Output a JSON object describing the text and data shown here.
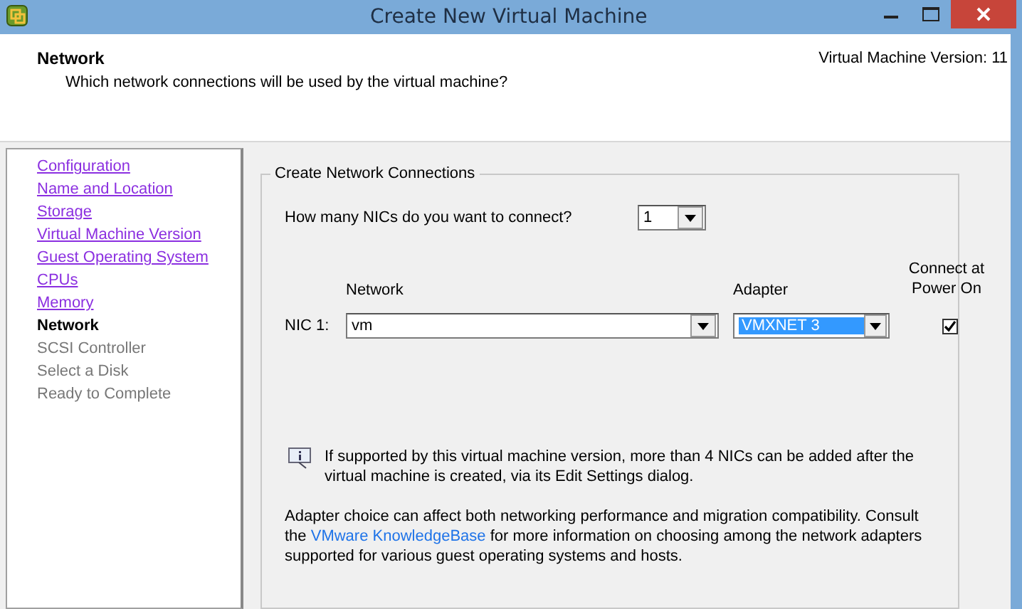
{
  "window": {
    "title": "Create New Virtual Machine"
  },
  "header": {
    "title": "Network",
    "subtitle": "Which network connections will be used by the virtual machine?",
    "version": "Virtual Machine Version: 11"
  },
  "steps": [
    {
      "label": "Configuration",
      "kind": "done"
    },
    {
      "label": "Name and Location",
      "kind": "done"
    },
    {
      "label": "Storage",
      "kind": "done"
    },
    {
      "label": "Virtual Machine Version",
      "kind": "done"
    },
    {
      "label": "Guest Operating System",
      "kind": "done"
    },
    {
      "label": "CPUs",
      "kind": "done"
    },
    {
      "label": "Memory",
      "kind": "done"
    },
    {
      "label": "Network",
      "kind": "current"
    },
    {
      "label": "SCSI Controller",
      "kind": "pending"
    },
    {
      "label": "Select a Disk",
      "kind": "pending"
    },
    {
      "label": "Ready to Complete",
      "kind": "pending"
    }
  ],
  "group": {
    "title": "Create Network Connections",
    "nic_count": {
      "label": "How many NICs do you want to connect?",
      "value": "1"
    },
    "columns": {
      "network": "Network",
      "adapter": "Adapter",
      "connect": "Connect at Power On"
    },
    "nics": [
      {
        "label": "NIC 1:",
        "network": "vm",
        "adapter": "VMXNET 3",
        "adapter_highlighted": true,
        "connect": true
      }
    ],
    "info": "If supported by this virtual machine version, more than 4 NICs can be added after the virtual machine is created, via its Edit Settings dialog.",
    "note": {
      "before": "Adapter choice can affect both networking performance and migration compatibility. Consult the",
      "link": "VMware KnowledgeBase",
      "after": "for more information on choosing among the network adapters supported for various guest operating systems and hosts."
    }
  }
}
